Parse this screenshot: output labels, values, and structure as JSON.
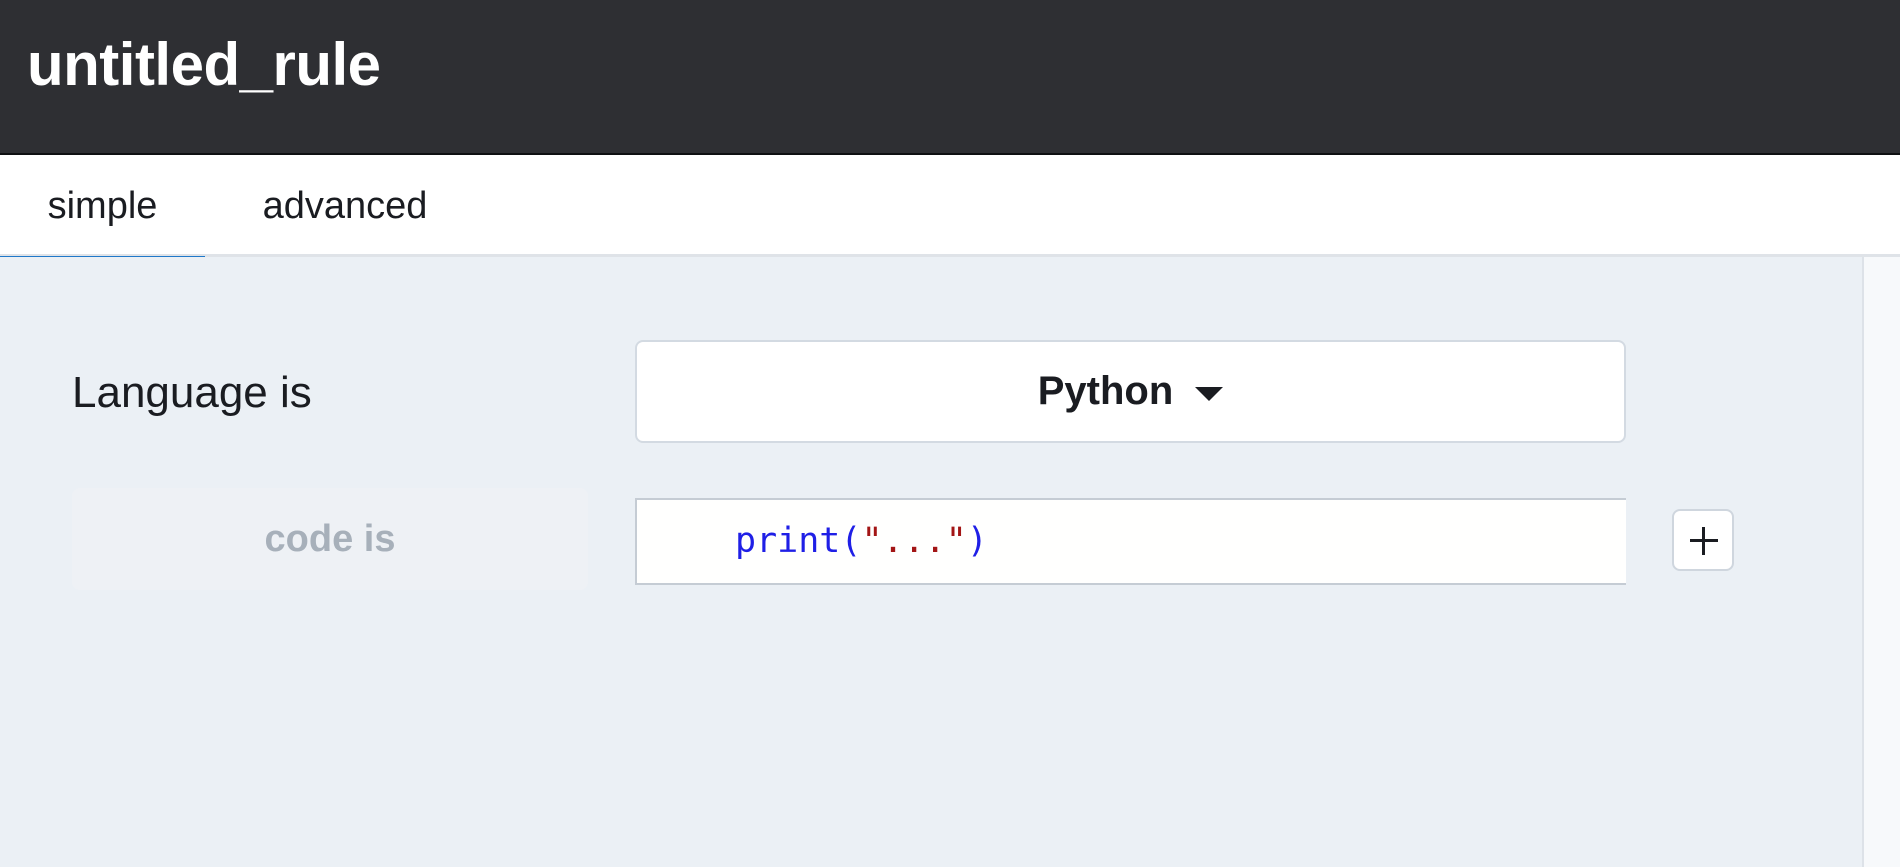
{
  "header": {
    "title": "untitled_rule"
  },
  "tabs": [
    {
      "label": "simple",
      "active": true
    },
    {
      "label": "advanced",
      "active": false
    }
  ],
  "rule": {
    "language_label": "Language is",
    "language_selected": "Python",
    "code_label": "code is",
    "code_tokens": {
      "func": "print(",
      "string": "\"...\"",
      "close": ")"
    }
  },
  "icons": {
    "dropdown": "caret-down-icon",
    "add": "plus-icon"
  },
  "colors": {
    "header_bg": "#2e2f33",
    "active_tab_underline": "#1f78c9",
    "main_bg": "#ebf0f5",
    "code_function": "#1f1fe6",
    "code_string": "#a31515"
  }
}
